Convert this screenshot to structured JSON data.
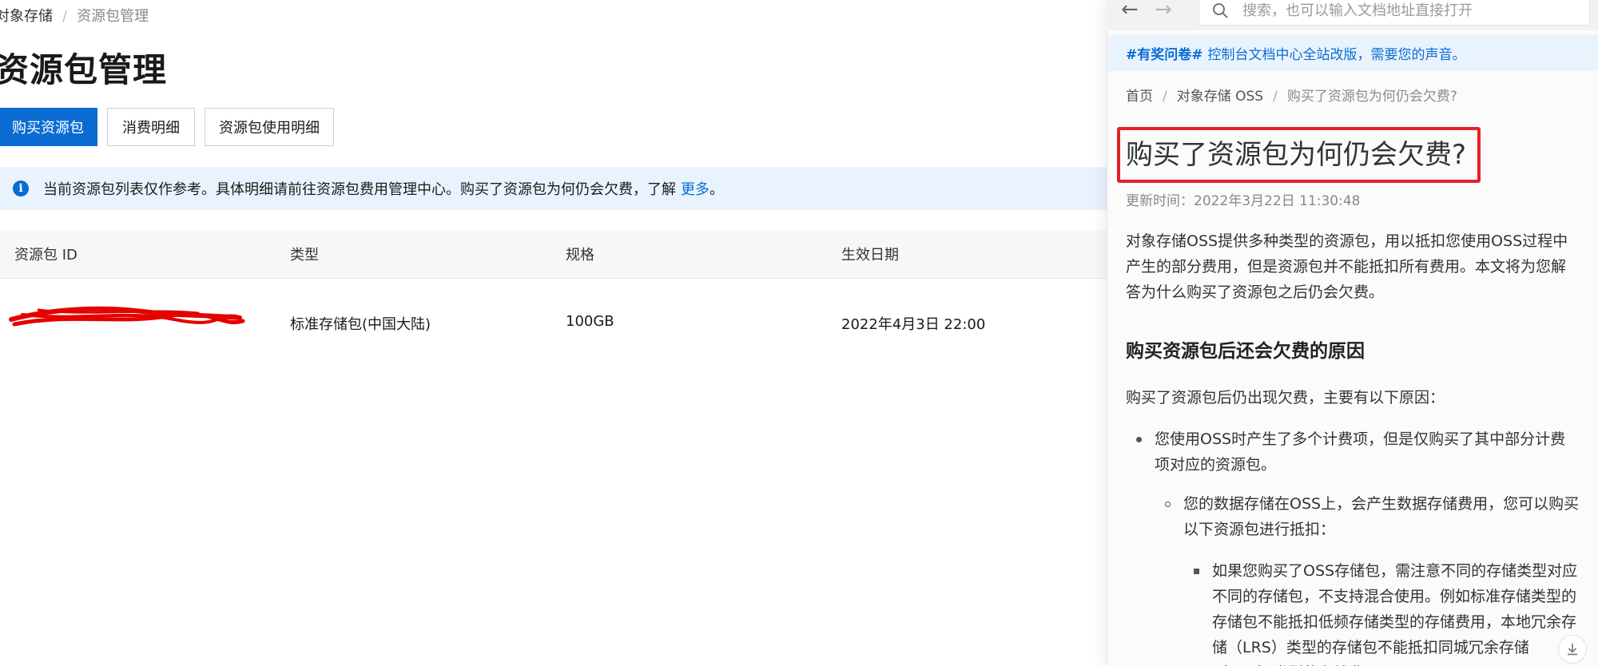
{
  "console": {
    "breadcrumb": {
      "root": "对象存储",
      "separator": "/",
      "current": "资源包管理"
    },
    "page_title": "资源包管理",
    "buttons": {
      "buy": "购买资源包",
      "consumption_detail": "消费明细",
      "usage_detail": "资源包使用明细"
    },
    "notice": {
      "text": "当前资源包列表仅作参考。具体明细请前往资源包费用管理中心。购买了资源包为何仍会欠费，了解",
      "link": "更多",
      "suffix": "。"
    },
    "table": {
      "columns": [
        "资源包 ID",
        "类型",
        "规格",
        "生效日期"
      ],
      "rows": [
        {
          "type": "标准存储包(中国大陆)",
          "spec": "100GB",
          "effective_date": "2022年4月3日 22:00"
        }
      ]
    }
  },
  "doc_panel": {
    "search": {
      "placeholder": "搜索，也可以输入文档地址直接打开",
      "value": ""
    },
    "announcement": {
      "tag": "#有奖问卷#",
      "text": "控制台文档中心全站改版，需要您的声音。"
    },
    "breadcrumb": {
      "home": "首页",
      "separator": "/",
      "product": "对象存储 OSS",
      "current": "购买了资源包为何仍会欠费?"
    },
    "title": "购买了资源包为何仍会欠费?",
    "updated": "更新时间：2022年3月22日 11:30:48",
    "intro": "对象存储OSS提供多种类型的资源包，用以抵扣您使用OSS过程中产生的部分费用，但是资源包并不能抵扣所有费用。本文将为您解答为什么购买了资源包之后仍会欠费。",
    "section_heading": "购买资源包后还会欠费的原因",
    "section_lead": "购买了资源包后仍出现欠费，主要有以下原因：",
    "bullet_1": "您使用OSS时产生了多个计费项，但是仅购买了其中部分计费项对应的资源包。",
    "bullet_1_1": "您的数据存储在OSS上，会产生数据存储费用，您可以购买以下资源包进行抵扣：",
    "bullet_1_1_1": "如果您购买了OSS存储包，需注意不同的存储类型对应不同的存储包，不支持混合使用。例如标准存储类型的存储包不能抵扣低频存储类型的存储费用，本地冗余存储（LRS）类型的存储包不能抵扣同城冗余存储（ZRS）类型的存储费用。"
  },
  "colors": {
    "primary": "#0a6cd3",
    "highlight_border": "#e5202b",
    "notice_bg": "#e9f3fd"
  },
  "icons": [
    "info-icon",
    "back-arrow-icon",
    "forward-arrow-icon",
    "search-icon",
    "download-icon"
  ]
}
